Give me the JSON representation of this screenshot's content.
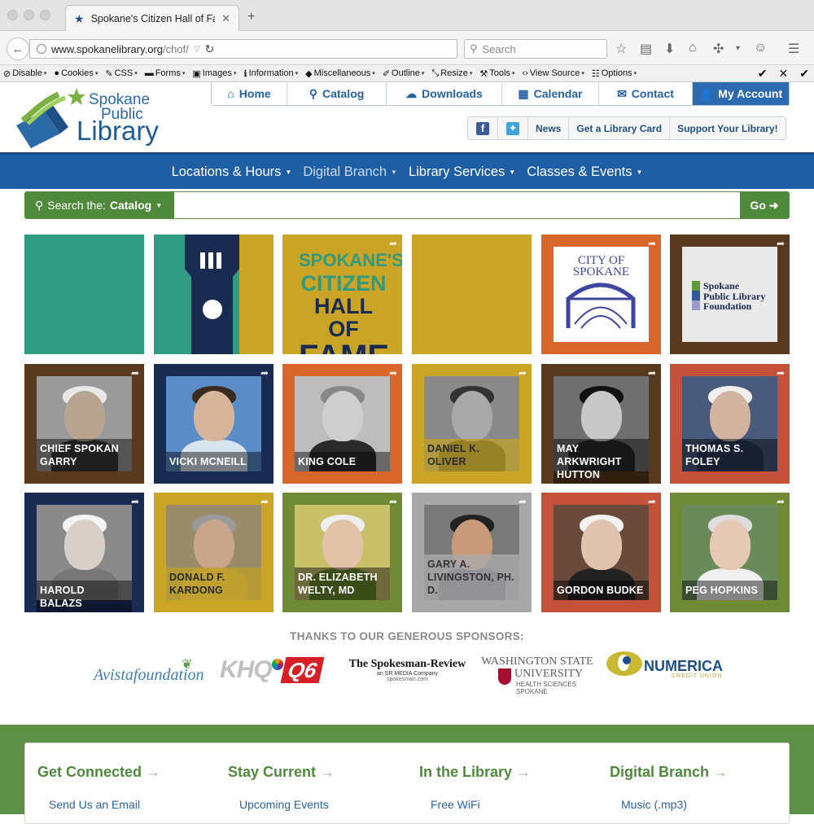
{
  "browser": {
    "tab_title": "Spokane's Citizen Hall of Fa…",
    "url_domain": "www.spokanelibrary.org",
    "url_path": "/chof/",
    "search_placeholder": "Search"
  },
  "devbar": {
    "items": [
      "Disable",
      "Cookies",
      "CSS",
      "Forms",
      "Images",
      "Information",
      "Miscellaneous",
      "Outline",
      "Resize",
      "Tools",
      "View Source",
      "Options"
    ]
  },
  "logo": {
    "line1": "Spokane",
    "line2": "Public",
    "line3": "Library"
  },
  "topnav": {
    "items": [
      {
        "label": "Home",
        "icon": "home-icon"
      },
      {
        "label": "Catalog",
        "icon": "search-icon"
      },
      {
        "label": "Downloads",
        "icon": "cloud-download-icon"
      },
      {
        "label": "Calendar",
        "icon": "calendar-icon"
      },
      {
        "label": "Contact",
        "icon": "envelope-icon"
      },
      {
        "label": "My Account",
        "icon": "user-icon"
      }
    ]
  },
  "subnav": {
    "news": "News",
    "card": "Get a Library Card",
    "support": "Support Your Library!"
  },
  "mainmenu": {
    "items": [
      "Locations & Hours",
      "Digital Branch",
      "Library Services",
      "Classes & Events"
    ]
  },
  "search": {
    "label_prefix": "Search the:",
    "label_target": "Catalog",
    "go": "Go"
  },
  "hero": {
    "chof_title": [
      "SPOKANE'S",
      "CITIZEN",
      "HALL OF",
      "FAME"
    ],
    "city_text": "CITY OF SPOKANE",
    "foundation_text": [
      "Spokane",
      "Public Library",
      "Foundation"
    ]
  },
  "people": [
    {
      "name": "CHIEF SPOKAN GARRY",
      "bg": "#5a3a1e"
    },
    {
      "name": "VICKI MCNEILL",
      "bg": "#1a2b52"
    },
    {
      "name": "KING COLE",
      "bg": "#d8662b"
    },
    {
      "name": "DANIEL K. OLIVER",
      "bg": "#caa424"
    },
    {
      "name": "MAY ARKWRIGHT HUTTON",
      "bg": "#5a3a1e"
    },
    {
      "name": "THOMAS S. FOLEY",
      "bg": "#c4523a"
    },
    {
      "name": "HAROLD BALAZS",
      "bg": "#1a2b52"
    },
    {
      "name": "DONALD F. KARDONG",
      "bg": "#caa424"
    },
    {
      "name": "DR. ELIZABETH WELTY, MD",
      "bg": "#6f8a35"
    },
    {
      "name": "GARY A. LIVINGSTON, PH. D.",
      "bg": "#a8a8a8"
    },
    {
      "name": "GORDON BUDKE",
      "bg": "#c4523a"
    },
    {
      "name": "PEG HOPKINS",
      "bg": "#6f8a35"
    }
  ],
  "sponsors": {
    "heading": "THANKS TO OUR GENEROUS SPONSORS:",
    "avista": "Avistafoundation",
    "khq": "KHQ",
    "khq_num": "Q6",
    "spokesman": "The Spokesman-Review",
    "spokesman_sub": "an SR MEDIA Company",
    "spokesman_url": "spokesman.com",
    "wsu1": "WASHINGTON STATE",
    "wsu2": "UNIVERSITY",
    "wsu3": "HEALTH SCIENCES",
    "wsu4": "SPOKANE",
    "numerica": "NUMERICA",
    "numerica_sub": "CREDIT UNION"
  },
  "footer": {
    "columns": [
      {
        "title": "Get Connected",
        "link": "Send Us an Email"
      },
      {
        "title": "Stay Current",
        "link": "Upcoming Events"
      },
      {
        "title": "In the Library",
        "link": "Free WiFi"
      },
      {
        "title": "Digital Branch",
        "link": "Music (.mp3)"
      }
    ]
  },
  "colors": {
    "brand_blue": "#1e5ea4",
    "brand_green": "#4f8a3c",
    "teal": "#2e9b82",
    "mustard": "#caa424",
    "orange": "#d8662b",
    "brown": "#5a3a1e",
    "navy": "#1a2b52"
  }
}
